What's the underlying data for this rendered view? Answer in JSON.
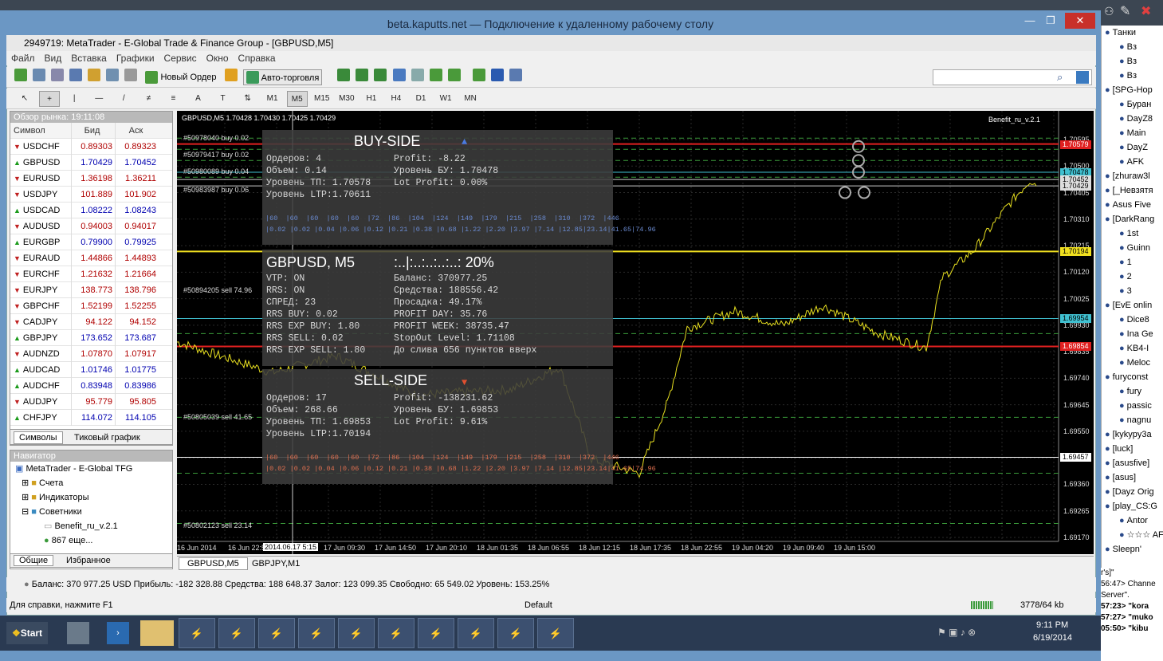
{
  "rdp": {
    "title": "beta.kaputts.net — Подключение к удаленному рабочему столу"
  },
  "window": {
    "title": "2949719: MetaTrader - E-Global Trade & Finance Group - [GBPUSD,M5]"
  },
  "menu": [
    "Файл",
    "Вид",
    "Вставка",
    "Графики",
    "Сервис",
    "Окно",
    "Справка"
  ],
  "toolbar": {
    "new_order": "Новый Ордер",
    "autotrade": "Авто-торговля"
  },
  "timeframes": [
    "M1",
    "M5",
    "M15",
    "M30",
    "H1",
    "H4",
    "D1",
    "W1",
    "MN"
  ],
  "active_timeframe": "M5",
  "drawtools": [
    "A"
  ],
  "market_watch": {
    "header": "Обзор рынка: 19:11:08",
    "cols": [
      "Символ",
      "Бид",
      "Аск"
    ],
    "rows": [
      {
        "s": "USDCHF",
        "bid": "0.89303",
        "ask": "0.89323",
        "dir": "dn"
      },
      {
        "s": "GBPUSD",
        "bid": "1.70429",
        "ask": "1.70452",
        "dir": "up"
      },
      {
        "s": "EURUSD",
        "bid": "1.36198",
        "ask": "1.36211",
        "dir": "dn"
      },
      {
        "s": "USDJPY",
        "bid": "101.889",
        "ask": "101.902",
        "dir": "dn"
      },
      {
        "s": "USDCAD",
        "bid": "1.08222",
        "ask": "1.08243",
        "dir": "up"
      },
      {
        "s": "AUDUSD",
        "bid": "0.94003",
        "ask": "0.94017",
        "dir": "dn"
      },
      {
        "s": "EURGBP",
        "bid": "0.79900",
        "ask": "0.79925",
        "dir": "up"
      },
      {
        "s": "EURAUD",
        "bid": "1.44866",
        "ask": "1.44893",
        "dir": "dn"
      },
      {
        "s": "EURCHF",
        "bid": "1.21632",
        "ask": "1.21664",
        "dir": "dn"
      },
      {
        "s": "EURJPY",
        "bid": "138.773",
        "ask": "138.796",
        "dir": "dn"
      },
      {
        "s": "GBPCHF",
        "bid": "1.52199",
        "ask": "1.52255",
        "dir": "dn"
      },
      {
        "s": "CADJPY",
        "bid": "94.122",
        "ask": "94.152",
        "dir": "dn"
      },
      {
        "s": "GBPJPY",
        "bid": "173.652",
        "ask": "173.687",
        "dir": "up"
      },
      {
        "s": "AUDNZD",
        "bid": "1.07870",
        "ask": "1.07917",
        "dir": "dn"
      },
      {
        "s": "AUDCAD",
        "bid": "1.01746",
        "ask": "1.01775",
        "dir": "up"
      },
      {
        "s": "AUDCHF",
        "bid": "0.83948",
        "ask": "0.83986",
        "dir": "up"
      },
      {
        "s": "AUDJPY",
        "bid": "95.779",
        "ask": "95.805",
        "dir": "dn"
      },
      {
        "s": "CHFJPY",
        "bid": "114.072",
        "ask": "114.105",
        "dir": "up"
      }
    ],
    "tabs": [
      "Символы",
      "Тиковый график"
    ]
  },
  "navigator": {
    "header": "Навигатор",
    "items": [
      "MetaTrader - E-Global TFG",
      "Счета",
      "Индикаторы",
      "Советники",
      "Benefit_ru_v.2.1",
      "867 еще..."
    ],
    "tabs": [
      "Общие",
      "Избранное"
    ]
  },
  "chart": {
    "info": "GBPUSD,M5  1.70428 1.70430 1.70425 1.70429",
    "indicator": "Benefit_ru_v.2.1",
    "prices": [
      "1.70595",
      "1.70500",
      "1.70405",
      "1.70310",
      "1.70215",
      "1.70120",
      "1.70025",
      "1.69930",
      "1.69835",
      "1.69740",
      "1.69645",
      "1.69550",
      "1.69455",
      "1.69360",
      "1.69265",
      "1.69170"
    ],
    "tags": [
      {
        "v": "1.70579",
        "color": "#e02020",
        "fg": "#fff"
      },
      {
        "v": "1.70478",
        "color": "#40c0d0",
        "fg": "#000"
      },
      {
        "v": "1.70452",
        "color": "#ddd",
        "fg": "#000"
      },
      {
        "v": "1.70429",
        "color": "#ddd",
        "fg": "#000"
      },
      {
        "v": "1.70194",
        "color": "#f0e020",
        "fg": "#000"
      },
      {
        "v": "1.69954",
        "color": "#40c0d0",
        "fg": "#000"
      },
      {
        "v": "1.69854",
        "color": "#e02020",
        "fg": "#fff"
      },
      {
        "v": "1.69457",
        "color": "#fff",
        "fg": "#000"
      }
    ],
    "orders": [
      "#50978040 buy 0.02",
      "#50979417 buy 0.02",
      "#50980089 buy 0.04",
      "#50983987 buy 0.06",
      "#50894205 sell 74.96",
      "#50805039 sell 41.65",
      "#50802123 sell 23.14"
    ],
    "times": [
      "16 Jun 2014",
      "16 Jun 22:55",
      "2014.06.17 5:15",
      "17 Jun 09:30",
      "17 Jun 14:50",
      "17 Jun 20:10",
      "18 Jun 01:35",
      "18 Jun 06:55",
      "18 Jun 12:15",
      "18 Jun 17:35",
      "18 Jun 22:55",
      "19 Jun 04:20",
      "19 Jun 09:40",
      "19 Jun 15:00"
    ],
    "tabs": [
      "GBPUSD,M5",
      "GBPJPY,M1"
    ]
  },
  "panel": {
    "buy_title": "BUY-SIDE",
    "buy_lines": [
      [
        "Ордеров: 4",
        "Profit: -8.22"
      ],
      [
        "Объем: 0.14",
        "Уровень БУ: 1.70478"
      ],
      [
        "Уровень ТП: 1.70578",
        "Lot Profit: 0.00%"
      ],
      [
        "Уровень LTP:1.70611",
        ""
      ]
    ],
    "buy_grid1": "|60  |60  |60  |60  |60  |72  |86  |104  |124  |149  |179  |215  |258  |310  |372  |446",
    "buy_grid2": "|0.02 |0.02 |0.04 |0.06 |0.12 |0.21 |0.38 |0.68 |1.22 |2.20 |3.97 |7.14 |12.85|23.14|41.65|74.96",
    "mid_title": "GBPUSD, M5",
    "mid_bar": ":..|:..:..:..:..: 20%",
    "mid_lines": [
      [
        "VTP: ON",
        "Баланс: 370977.25"
      ],
      [
        "RRS: ON",
        "Средства: 188556.42"
      ],
      [
        "СПРЕД: 23",
        "Просадка: 49.17%"
      ],
      [
        "RRS BUY: 0.02",
        "PROFIT DAY: 35.76"
      ],
      [
        "RRS EXP BUY: 1.80",
        "PROFIT WEEK: 38735.47"
      ],
      [
        "RRS SELL: 0.02",
        "StopOut Level: 1.71108"
      ],
      [
        "RRS EXP SELL: 1.80",
        "До слива 656 пунктов вверх"
      ]
    ],
    "sell_title": "SELL-SIDE",
    "sell_lines": [
      [
        "Ордеров: 17",
        "Profit: -138231.62"
      ],
      [
        "Объем: 268.66",
        "Уровень БУ: 1.69853"
      ],
      [
        "Уровень ТП: 1.69853",
        "Lot Profit: 9.61%"
      ],
      [
        "Уровень LTP:1.70194",
        ""
      ]
    ],
    "sell_grid1": "|60  |60  |60  |60  |60  |72  |86  |104  |124  |149  |179  |215  |258  |310  |372  |446",
    "sell_grid2": "|0.02 |0.02 |0.04 |0.06 |0.12 |0.21 |0.38 |0.68 |1.22 |2.20 |3.97 |7.14 |12.85|23.14|41.65|74.96"
  },
  "status": "Баланс: 370 977.25 USD  Прибыль: -182 328.88  Средства: 188 648.37  Залог: 123 099.35  Свободно: 65 549.02  Уровень: 153.25%",
  "helpbar": {
    "left": "Для справки, нажмите F1",
    "mid": "Default",
    "right": "3778/64 kb"
  },
  "taskbar": {
    "start": "Start",
    "time": "9:11 PM",
    "date": "6/19/2014"
  },
  "right_panel": [
    "Танки",
    "Вз",
    "Вз",
    "Вз",
    "[SPG-Hop",
    "Буран",
    "DayZ8",
    "Main",
    "DayZ",
    "AFK",
    "[zhuraw3l",
    "[_Невзятя",
    "Asus Five",
    "[DarkRang",
    "1st",
    "Guinn",
    "1",
    "2",
    "3",
    "[EvE onlin",
    "Dice8",
    "Ina Ge",
    "KB4-I",
    "Meloc",
    "furyconst",
    "fury",
    "passic",
    "nagnu",
    "[kykypy3a",
    "[luck]",
    "[asusfive]",
    "[asus]",
    "[Dayz Orig",
    "[play_CS:G",
    "Antor",
    "☆☆☆ AF",
    "Sleepn'"
  ],
  "chat": [
    "r's]\"",
    "56:47> Channe",
    "Server\".",
    "57:23> \"kora",
    "57:27> \"muko",
    "05:50> \"kibu"
  ]
}
